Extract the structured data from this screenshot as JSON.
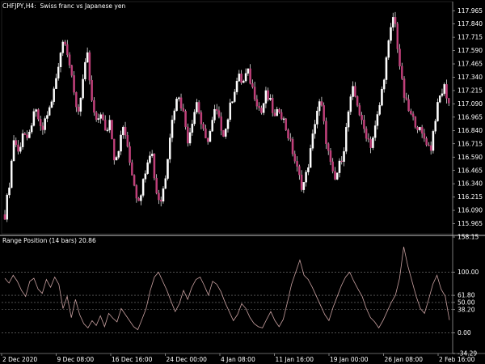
{
  "header": {
    "symbol": "CHFJPY,",
    "timeframe": "H4:",
    "description": "Swiss franc vs Japanese yen"
  },
  "indicator": {
    "title": "Range Position (14 bars) 20.86"
  },
  "colors": {
    "background": "#000000",
    "up_candle_body": "#ffffff",
    "down_candle_body": "#c0407a",
    "wick": "#ffffff",
    "indicator_line": "#c8a0a0",
    "level_line": "#808080",
    "separator": "#c8c8c8"
  },
  "chart_data": [
    {
      "type": "candlestick",
      "symbol": "CHFJPY",
      "timeframe": "H4",
      "title": "Swiss franc vs Japanese yen",
      "ylim": [
        115.87,
        118.05
      ],
      "y_ticks": [
        "117.965",
        "117.840",
        "117.715",
        "117.590",
        "117.465",
        "117.340",
        "117.215",
        "117.090",
        "116.965",
        "116.840",
        "116.715",
        "116.590",
        "116.465",
        "116.340",
        "116.215",
        "116.090",
        "115.965"
      ],
      "x_tick_labels": [
        "2 Dec 2020",
        "9 Dec 08:00",
        "16 Dec 16:00",
        "24 Dec 00:00",
        "4 Jan 08:00",
        "11 Jan 16:00",
        "19 Jan 00:00",
        "26 Jan 08:00",
        "2 Feb 16:00"
      ],
      "close_path": [
        116.05,
        116.35,
        116.78,
        116.62,
        116.85,
        116.71,
        116.95,
        117.02,
        116.8,
        116.98,
        117.05,
        117.28,
        117.55,
        117.73,
        117.5,
        117.2,
        117.0,
        117.3,
        117.55,
        117.1,
        116.9,
        117.02,
        116.8,
        116.95,
        116.55,
        116.7,
        116.9,
        116.6,
        116.4,
        116.18,
        116.3,
        116.55,
        116.68,
        116.28,
        116.16,
        116.38,
        116.78,
        117.05,
        117.18,
        117.0,
        116.75,
        116.95,
        117.12,
        116.88,
        116.72,
        116.85,
        117.05,
        116.9,
        116.8,
        117.02,
        117.2,
        117.35,
        117.28,
        117.4,
        117.25,
        117.12,
        117.0,
        117.18,
        117.1,
        116.95,
        117.05,
        116.92,
        116.78,
        116.62,
        116.45,
        116.3,
        116.45,
        116.7,
        117.0,
        117.12,
        116.8,
        116.55,
        116.35,
        116.5,
        116.65,
        117.0,
        117.22,
        117.1,
        116.9,
        116.8,
        116.7,
        116.88,
        117.1,
        117.4,
        117.7,
        117.95,
        117.55,
        117.2,
        117.05,
        116.95,
        116.9,
        116.8,
        116.75,
        116.65,
        116.95,
        117.15,
        117.25,
        117.1
      ]
    },
    {
      "type": "line",
      "title": "Range Position (14 bars)",
      "current_value": 20.86,
      "ylim": [
        -34.29,
        158.15
      ],
      "y_ticks": [
        "158.15",
        "100.00",
        "61.80",
        "50.00",
        "38.20",
        "0.00",
        "-34.29"
      ],
      "levels": [
        100.0,
        61.8,
        50.0,
        38.2,
        0.0
      ],
      "values": [
        90,
        82,
        95,
        85,
        70,
        60,
        85,
        90,
        72,
        65,
        88,
        75,
        92,
        80,
        40,
        60,
        25,
        55,
        30,
        15,
        8,
        20,
        12,
        28,
        10,
        32,
        24,
        18,
        40,
        30,
        20,
        10,
        5,
        22,
        40,
        70,
        92,
        100,
        85,
        70,
        52,
        35,
        48,
        70,
        55,
        75,
        88,
        92,
        78,
        62,
        85,
        80,
        68,
        50,
        35,
        20,
        30,
        48,
        40,
        25,
        15,
        10,
        8,
        22,
        35,
        20,
        10,
        22,
        50,
        80,
        100,
        120,
        95,
        88,
        75,
        60,
        45,
        30,
        20,
        42,
        60,
        78,
        92,
        100,
        85,
        72,
        60,
        40,
        25,
        18,
        8,
        20,
        35,
        50,
        62,
        90,
        142,
        110,
        85,
        60,
        40,
        32,
        55,
        80,
        95,
        72,
        60,
        20.86
      ]
    }
  ]
}
